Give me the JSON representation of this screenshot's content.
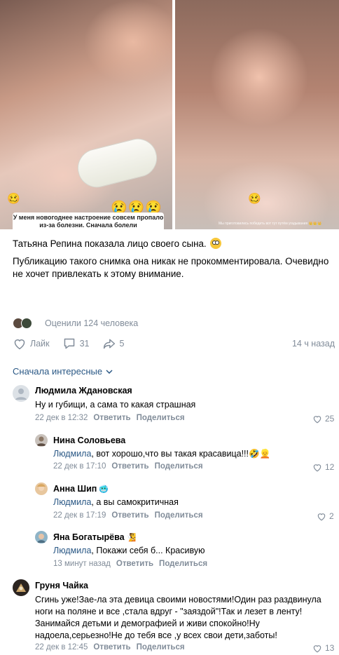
{
  "photos": {
    "left_caption": "У меня новогоднее настроение совсем пропало из-за болезни. Сначала болели",
    "left_emojis": "😢😢😢",
    "left_icon": "🥴",
    "right_caption": "Мы приготовились победить вот тут путём угадывания 👑👑👑",
    "right_icon": "🥴"
  },
  "post": {
    "line1": "Татьяна Репина показала лицо своего сына.",
    "line2": "Публикацию такого снимка она никак не прокомментировала. Очевидно не хочет привлекать к этому внимание."
  },
  "rated": "Оценили 124 человека",
  "actions": {
    "like_label": "Лайк",
    "comments_count": "31",
    "shares_count": "5",
    "time": "14 ч назад"
  },
  "sort_label": "Сначала интересные",
  "comments": [
    {
      "name": "Людмила Ждановская",
      "name_emoji": "",
      "reply_to": "",
      "text": "Ну и губищи, а сама то какая страшная",
      "date": "22 дек в 12:32",
      "reply": "Ответить",
      "share": "Поделиться",
      "likes": "25"
    },
    {
      "name": "Нина Соловьева",
      "name_emoji": "",
      "reply_to": "Людмила",
      "text": ", вот хорошо,что вы такая красавица!!!🤣👱",
      "date": "22 дек в 17:10",
      "reply": "Ответить",
      "share": "Поделиться",
      "likes": "12"
    },
    {
      "name": "Анна Шип",
      "name_emoji": "🥶",
      "reply_to": "Людмила",
      "text": ", а вы самокритичная",
      "date": "22 дек в 17:19",
      "reply": "Ответить",
      "share": "Поделиться",
      "likes": "2"
    },
    {
      "name": "Яна Богатырёва",
      "name_emoji": "🧏",
      "reply_to": "Людмила",
      "text": ", Покажи себя б... Красивую",
      "date": "13 минут назад",
      "reply": "Ответить",
      "share": "Поделиться",
      "likes": ""
    },
    {
      "name": "Груня Чайка",
      "name_emoji": "",
      "reply_to": "",
      "text": "Сгинь уже!Зае-ла эта девица своими новостями!Один раз раздвинула ноги на поляне и все ,стала вдруг - \"заяздой\"!Так и лезет в ленту! Занимайся детьми и демографией и живи спокойно!Ну надоела,серьезно!Не до тебя все ,у всех свои дети,заботы!",
      "date": "22 дек в 12:45",
      "reply": "Ответить",
      "share": "Поделиться",
      "likes": "13"
    }
  ],
  "colors": {
    "link": "#2a5885",
    "secondary": "#818c99"
  }
}
